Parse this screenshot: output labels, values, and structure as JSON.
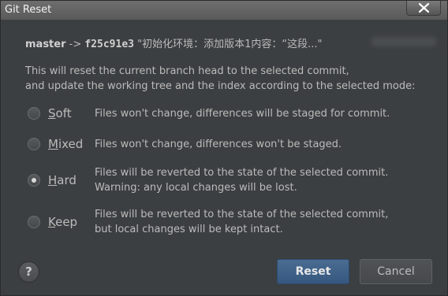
{
  "window": {
    "title": "Git Reset"
  },
  "commit": {
    "branch": "master",
    "arrow": " -> ",
    "hash": "f25c91e3",
    "message": " \"初始化环境：添加版本1内容：“这段...\""
  },
  "description": {
    "line1": "This will reset the current branch head to the selected commit,",
    "line2": "and update the working tree and the index according to the selected mode:"
  },
  "modes": [
    {
      "label": "Soft",
      "desc1": "Files won't change, differences will be staged for commit.",
      "desc2": "",
      "checked": false
    },
    {
      "label": "Mixed",
      "desc1": "Files won't change, differences won't be staged.",
      "desc2": "",
      "checked": false
    },
    {
      "label": "Hard",
      "desc1": "Files will be reverted to the state of the selected commit.",
      "desc2": "Warning: any local changes will be lost.",
      "checked": true
    },
    {
      "label": "Keep",
      "desc1": "Files will be reverted to the state of the selected commit,",
      "desc2": "but local changes will be kept intact.",
      "checked": false
    }
  ],
  "buttons": {
    "help": "?",
    "reset": "Reset",
    "cancel": "Cancel"
  },
  "colors": {
    "background": "#3c3f41",
    "primary_button": "#365880",
    "text": "#bbbbbb"
  },
  "icons": {
    "close": "close-icon",
    "help": "help-icon"
  }
}
